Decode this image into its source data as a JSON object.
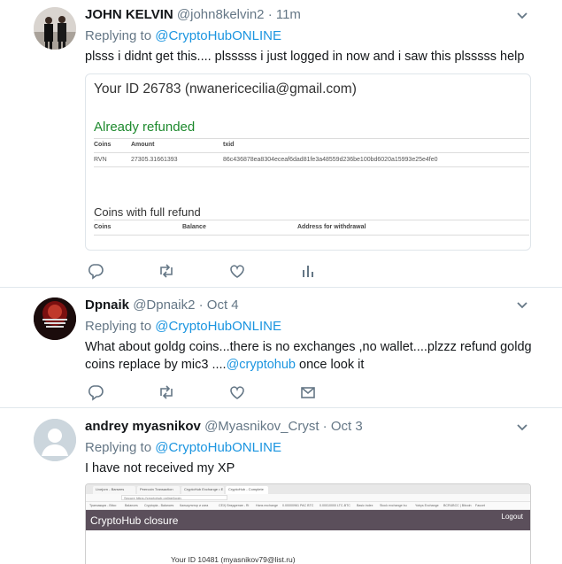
{
  "tweets": [
    {
      "name": "JOHN KELVIN",
      "handle": "@john8kelvin2 · 11m",
      "replying_prefix": "Replying to ",
      "replying_to": "@CryptoHubONLINE",
      "text": "plsss i didnt get this.... plsssss i just logged in now and i saw this plsssss help"
    },
    {
      "name": "Dpnaik",
      "handle": "@Dpnaik2 · Oct 4",
      "replying_prefix": "Replying to ",
      "replying_to": "@CryptoHubONLINE",
      "text_line1": "What about goldg coins...there is no exchanges ,no wallet....plzzz refund goldg",
      "text_line2_prefix": "coins replace by mic3 ....",
      "text_line2_mention": "@cryptohub",
      "text_line2_suffix": " once look it",
      "avatar_text": "THE LEVEL OF YOUR SUCCESS DEPENDS ON HOW BAD YOU WANT IT"
    },
    {
      "name": "andrey myasnikov",
      "handle": "@Myasnikov_Cryst · Oct 3",
      "replying_prefix": "Replying to ",
      "replying_to": "@CryptoHubONLINE",
      "text": "I have not received my XP"
    }
  ],
  "card1": {
    "id_line": "Your ID 26783 (nwanericecilia@gmail.com)",
    "status": "Already refunded",
    "table1_headers": [
      "Coins",
      "Amount",
      "txid"
    ],
    "table1_row": [
      "RVN",
      "27305.31661393",
      "86c436878ea8304eceaf6dad81fe3a48559d236be100bd6020a15993e25e4fe0"
    ],
    "full_refund_title": "Coins with full refund",
    "table2_headers": [
      "Coins",
      "Balance",
      "Address for withdrawal"
    ]
  },
  "card2": {
    "tabs": [
      "Livejorn - Barsees",
      "Peercoin Transaction",
      "CryptoHub Exchange • E",
      "CryptoHub - Complete"
    ],
    "url": "Secure https://cryptohub.online/login",
    "bookmarks": [
      "Транзакция - Bitco",
      "Balances",
      "Cryptopia - Balances",
      "Калькулятор и ката",
      "CEX| Внедрение - Ri",
      "Hans exchange",
      "0.00000961 PAC BTC",
      "0.00010000 LTC-BTC",
      "Basic index",
      "Stock exchange bu",
      "Yobys Exchange",
      "BCRUBCC | Bitcoin",
      "Faucet"
    ],
    "title": "CryptoHub closure",
    "logout": "Logout",
    "id_line": "Your ID 10481 (myasnikov79@list.ru)"
  },
  "colors": {
    "link": "#1b95e0",
    "muted": "#657786",
    "refund_green": "#1e8a2e",
    "header_bar": "#5b4f5b"
  },
  "icons": [
    "reply-icon",
    "retweet-icon",
    "like-icon",
    "analytics-icon",
    "message-icon",
    "chevron-down-icon"
  ]
}
